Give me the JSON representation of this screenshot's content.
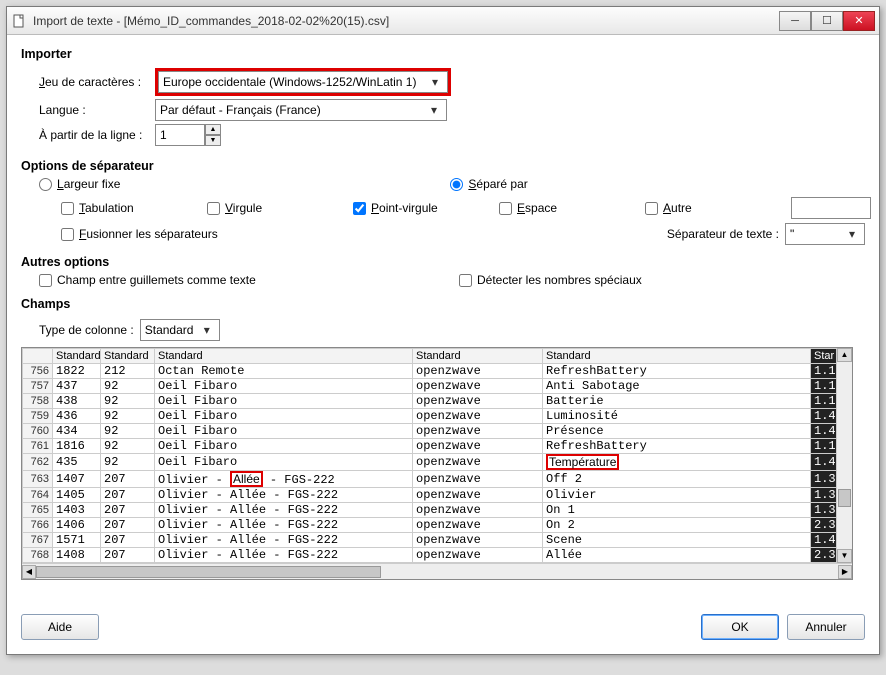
{
  "window": {
    "title": "Import de texte - [Mémo_ID_commandes_2018-02-02%20(15).csv]"
  },
  "import": {
    "header": "Importer",
    "charset_label": "Jeu de caractères :",
    "charset_value": "Europe occidentale (Windows-1252/WinLatin 1)",
    "lang_label": "Langue :",
    "lang_value": "Par défaut - Français (France)",
    "fromline_label": "À partir de la ligne :",
    "fromline_value": "1"
  },
  "separator": {
    "header": "Options de séparateur",
    "fixed_label": "Largeur fixe",
    "sep_label": "Séparé par",
    "tab_label": "Tabulation",
    "comma_label": "Virgule",
    "semicolon_label": "Point-virgule",
    "space_label": "Espace",
    "other_label": "Autre",
    "other_value": "",
    "merge_label": "Fusionner les séparateurs",
    "textsep_label": "Séparateur de texte :",
    "textsep_value": "\""
  },
  "other": {
    "header": "Autres options",
    "quoted_label": "Champ entre guillemets comme texte",
    "detect_label": "Détecter les nombres spéciaux"
  },
  "fields": {
    "header": "Champs",
    "type_label": "Type de colonne :",
    "type_value": "Standard",
    "col_headers": [
      "Standard",
      "Standard",
      "Standard",
      "Standard",
      "Standard",
      "Star"
    ],
    "rows": [
      {
        "n": "756",
        "c": [
          "1822",
          "212",
          "Octan Remote",
          "openzwave",
          "RefreshBattery",
          "1.1"
        ]
      },
      {
        "n": "757",
        "c": [
          "437",
          "92",
          "Oeil Fibaro",
          "openzwave",
          "Anti Sabotage",
          "1.1"
        ]
      },
      {
        "n": "758",
        "c": [
          "438",
          "92",
          "Oeil Fibaro",
          "openzwave",
          "Batterie",
          "1.1"
        ]
      },
      {
        "n": "759",
        "c": [
          "436",
          "92",
          "Oeil Fibaro",
          "openzwave",
          "Luminosité",
          "1.4"
        ]
      },
      {
        "n": "760",
        "c": [
          "434",
          "92",
          "Oeil Fibaro",
          "openzwave",
          "Présence",
          "1.4"
        ]
      },
      {
        "n": "761",
        "c": [
          "1816",
          "92",
          "Oeil Fibaro",
          "openzwave",
          "RefreshBattery",
          "1.1"
        ]
      },
      {
        "n": "762",
        "c": [
          "435",
          "92",
          "Oeil Fibaro",
          "openzwave",
          "Température",
          "1.4"
        ],
        "hl5": true
      },
      {
        "n": "763",
        "c": [
          "1407",
          "207",
          "Olivier - Allée - FGS-222",
          "openzwave",
          "Off 2",
          "1.3"
        ],
        "hl3": "Allée"
      },
      {
        "n": "764",
        "c": [
          "1405",
          "207",
          "Olivier - Allée - FGS-222",
          "openzwave",
          "Olivier",
          "1.3"
        ]
      },
      {
        "n": "765",
        "c": [
          "1403",
          "207",
          "Olivier - Allée - FGS-222",
          "openzwave",
          "On 1",
          "1.3"
        ]
      },
      {
        "n": "766",
        "c": [
          "1406",
          "207",
          "Olivier - Allée - FGS-222",
          "openzwave",
          "On 2",
          "2.3"
        ]
      },
      {
        "n": "767",
        "c": [
          "1571",
          "207",
          "Olivier - Allée - FGS-222",
          "openzwave",
          "Scene",
          "1.4"
        ]
      },
      {
        "n": "768",
        "c": [
          "1408",
          "207",
          "Olivier - Allée - FGS-222",
          "openzwave",
          "Allée",
          "2.3"
        ]
      }
    ]
  },
  "buttons": {
    "help": "Aide",
    "ok": "OK",
    "cancel": "Annuler"
  }
}
